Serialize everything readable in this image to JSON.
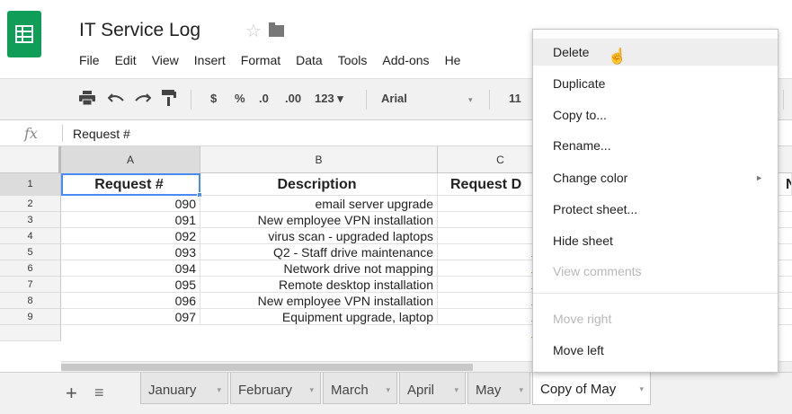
{
  "doc": {
    "title": "IT Service Log",
    "star": "☆"
  },
  "menubar": [
    "File",
    "Edit",
    "View",
    "Insert",
    "Format",
    "Data",
    "Tools",
    "Add-ons",
    "He"
  ],
  "toolbar": {
    "currency": "$",
    "percent": "%",
    "dec_decrease": ".0",
    "dec_increase": ".00",
    "more_formats": "123 ▾",
    "font": "Arial",
    "font_caret": "▾",
    "font_size": "11"
  },
  "formula_bar": {
    "fx": "fx",
    "value": "Request #"
  },
  "columns": [
    "A",
    "B",
    "C"
  ],
  "header_row": {
    "num": "1",
    "a": "Request #",
    "b": "Description",
    "c": "Request D",
    "d": "N"
  },
  "rows": [
    {
      "num": "2",
      "a": "090",
      "b": "email server upgrade"
    },
    {
      "num": "3",
      "a": "091",
      "b": "New employee VPN installation"
    },
    {
      "num": "4",
      "a": "092",
      "b": "virus scan - upgraded laptops"
    },
    {
      "num": "5",
      "a": "093",
      "b": "Q2 - Staff drive maintenance"
    },
    {
      "num": "6",
      "a": "094",
      "b": "Network drive not mapping"
    },
    {
      "num": "7",
      "a": "095",
      "b": "Remote desktop installation"
    },
    {
      "num": "8",
      "a": "096",
      "b": "New employee VPN installation"
    },
    {
      "num": "9",
      "a": "097",
      "b": "Equipment upgrade, laptop"
    }
  ],
  "tabbar": {
    "add": "+",
    "all": "≡",
    "tabs": [
      {
        "label": "January"
      },
      {
        "label": "February"
      },
      {
        "label": "March"
      },
      {
        "label": "April"
      },
      {
        "label": "May"
      },
      {
        "label": "Copy of May"
      }
    ],
    "caret": "▾"
  },
  "context_menu": {
    "items": [
      {
        "label": "Delete",
        "state": "hover"
      },
      {
        "label": "Duplicate"
      },
      {
        "label": "Copy to..."
      },
      {
        "label": "Rename..."
      },
      {
        "label": "Change color",
        "submenu_arrow": "►"
      },
      {
        "label": "Protect sheet..."
      },
      {
        "label": "Hide sheet"
      },
      {
        "label": "View comments",
        "state": "disabled"
      },
      {
        "label": "Move right",
        "state": "disabled"
      },
      {
        "label": "Move left"
      }
    ]
  },
  "colors": {
    "brand_green": "#0f9d58",
    "selection_blue": "#4a8af4"
  }
}
